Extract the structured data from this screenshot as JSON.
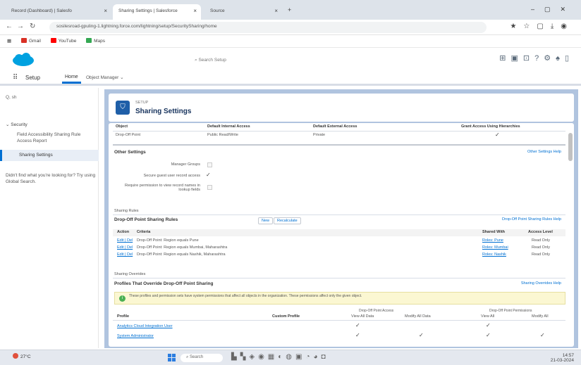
{
  "browser": {
    "tabs": [
      {
        "title": "Record (Dashboard) | Salesfo"
      },
      {
        "title": "Sharing Settings | Salesforce"
      },
      {
        "title": "Source"
      }
    ],
    "url": "sosilesroad-gpuling-1.lightning.force.com/lightning/setup/SecuritySharing/home",
    "bookmarks": [
      "Gmail",
      "YouTube",
      "Maps"
    ]
  },
  "sf": {
    "search_placeholder": "Search Setup",
    "app_name": "Setup",
    "tabs": {
      "home": "Home",
      "object_manager": "Object Manager"
    }
  },
  "sidebar": {
    "quickfind": "Q, sh",
    "security": "Security",
    "field_accessibility": "Field Accessibility Sharing Rule Access Report",
    "sharing_settings": "Sharing Settings",
    "help": "Didn't find what you're looking for? Try using Global Search."
  },
  "page": {
    "kicker": "SETUP",
    "title": "Sharing Settings"
  },
  "defaults_table": {
    "headers": [
      "Object",
      "Default Internal Access",
      "Default External Access",
      "Grant Access Using Hierarchies"
    ],
    "row": [
      "Drop-Off Point",
      "Public Read/Write",
      "Private",
      "✓"
    ]
  },
  "other_settings": {
    "title": "Other Settings",
    "link": "Other Settings Help",
    "items": [
      "Manager Groups",
      "Secure guest user record access",
      "Require permission to view record names in lookup fields"
    ]
  },
  "sharing_rules": {
    "kicker": "Sharing Rules",
    "title": "Drop-Off Point Sharing Rules",
    "new_button": "New",
    "recalc_button": "Recalculate",
    "help_link": "Drop-Off Point Sharing Rules Help",
    "headers": [
      "Action",
      "Criteria",
      "Shared With",
      "Access Level"
    ],
    "rows": [
      {
        "action": "Edit | Del",
        "criteria": "Drop-Off Point: Region  equals  Pune",
        "shared_with": "Roles: Pune",
        "access": "Read Only"
      },
      {
        "action": "Edit | Del",
        "criteria": "Drop-Off Point: Region  equals  Mumbai, Maharashtra",
        "shared_with": "Roles: Mumbai",
        "access": "Read Only"
      },
      {
        "action": "Edit | Del",
        "criteria": "Drop-Off Point: Region  equals  Nashik, Maharashtra",
        "shared_with": "Roles: Nashik",
        "access": "Read Only"
      }
    ]
  },
  "profile_overrides": {
    "kicker": "Sharing Overrides",
    "title": "Profiles That Override Drop-Off Point Sharing",
    "help_link": "Sharing Overrides Help",
    "info": "These profiles and permission sets have system permissions that affect all objects in the organization. These permissions affect only the given object.",
    "group_headers": [
      "Drop-Off Point Access",
      "Drop-Off Point Permissions"
    ],
    "headers": [
      "Profile",
      "Custom Profile",
      "View All Data",
      "Modify All Data",
      "View All",
      "Modify All"
    ],
    "rows": [
      {
        "profile": "Analytics Cloud Integration User",
        "checks": [
          "✓",
          "",
          "✓",
          ""
        ]
      },
      {
        "profile": "System Administrator",
        "checks": [
          "✓",
          "✓",
          "✓",
          "✓"
        ]
      }
    ]
  },
  "taskbar": {
    "weather": "27°C",
    "search": "Search",
    "clock_time": "14:57",
    "clock_date": "21-03-2024"
  },
  "colors": {
    "brand_blue": "#0070d2",
    "main_bg": "#b0c4df",
    "header_icon": "#1f5fa8"
  }
}
